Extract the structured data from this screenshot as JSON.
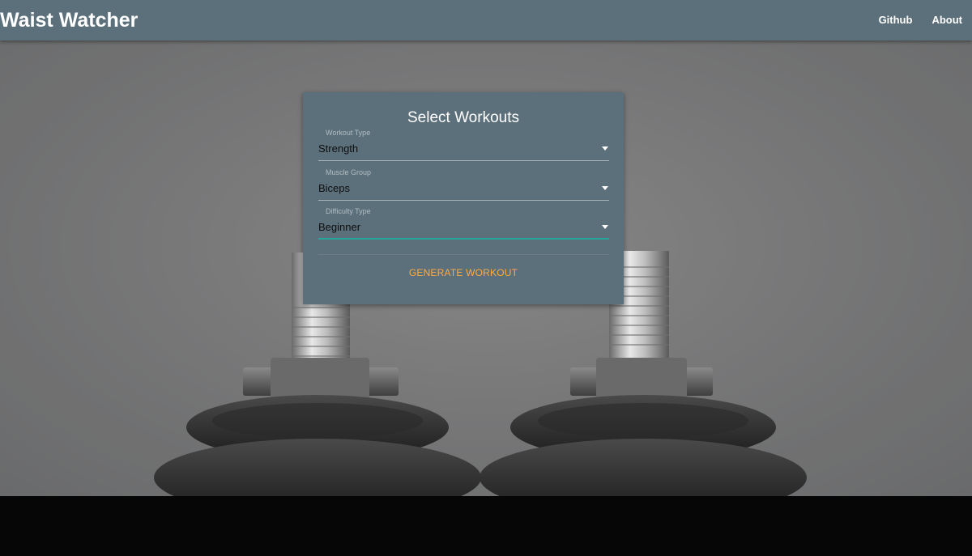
{
  "navbar": {
    "brand": "Waist Watcher",
    "links": [
      "Github",
      "About"
    ]
  },
  "card": {
    "title": "Select Workouts",
    "fields": [
      {
        "label": "Workout Type",
        "value": "Strength"
      },
      {
        "label": "Muscle Group",
        "value": "Biceps"
      },
      {
        "label": "Difficulty Type",
        "value": "Beginner"
      }
    ],
    "button_label": "GENERATE WORKOUT"
  },
  "colors": {
    "nav_bg": "#5c707b",
    "card_bg": "#5c707b",
    "accent_button": "#ffab40",
    "active_underline": "#26a69a",
    "bottom_band": "#060606"
  },
  "icons": [
    "dropdown-caret-icon",
    "background-dumbbells-photo"
  ]
}
